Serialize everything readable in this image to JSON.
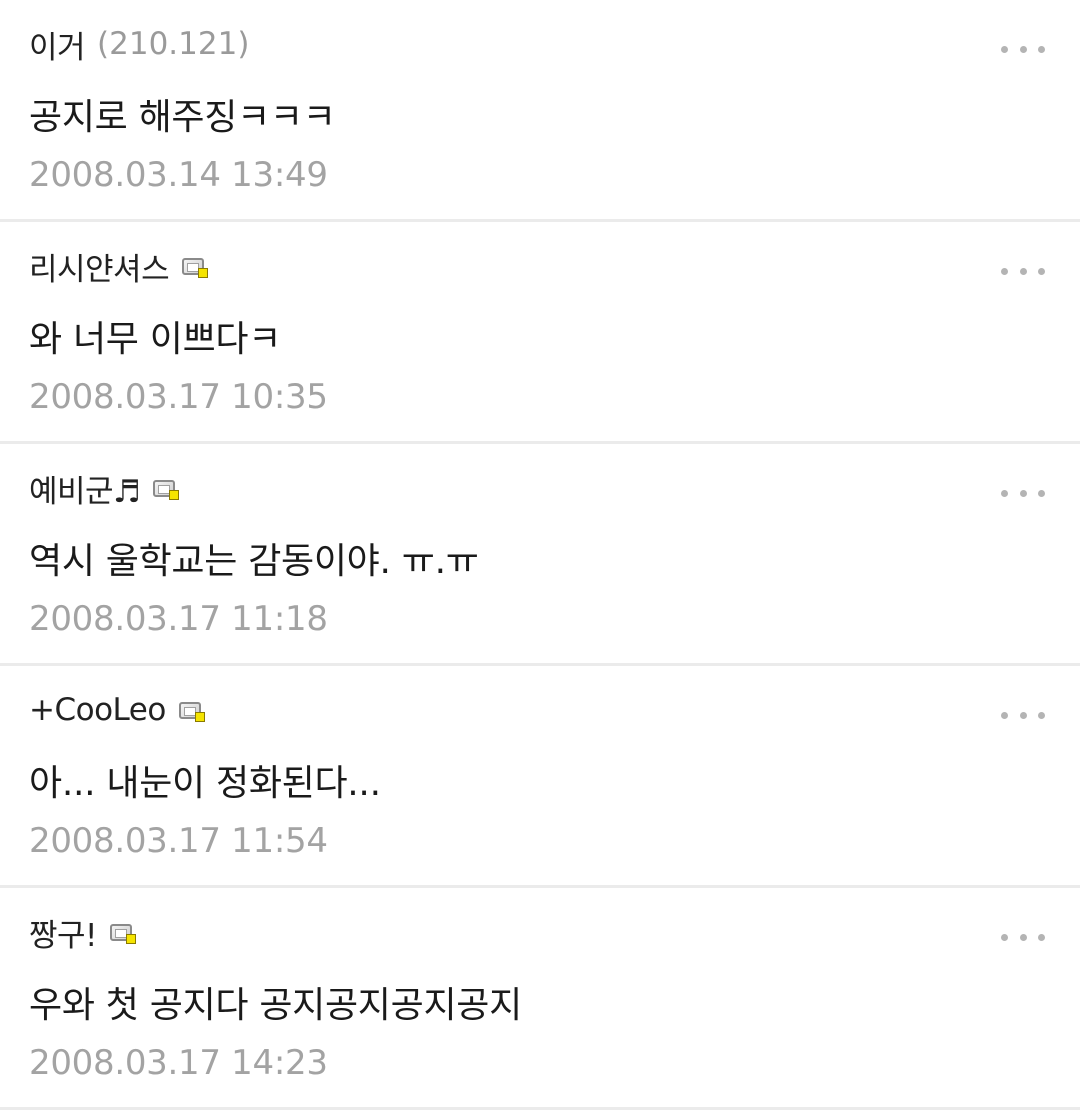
{
  "comments": [
    {
      "author": "이거",
      "ip": "(210.121)",
      "text": "공지로 해주징ㅋㅋㅋ",
      "time": "2008.03.14 13:49",
      "has_mobile_icon": false
    },
    {
      "author": "리시얀셔스",
      "ip": "",
      "text": "와 너무 이쁘다ㅋ",
      "time": "2008.03.17 10:35",
      "has_mobile_icon": true
    },
    {
      "author": "예비군♬",
      "ip": "",
      "text": "역시 울학교는 감동이야. ㅠ.ㅠ",
      "time": "2008.03.17 11:18",
      "has_mobile_icon": true
    },
    {
      "author": "+CooLeo",
      "ip": "",
      "text": "아... 내눈이 정화된다...",
      "time": "2008.03.17 11:54",
      "has_mobile_icon": true
    },
    {
      "author": "짱구!",
      "ip": "",
      "text": "우와 첫 공지다 공지공지공지공지",
      "time": "2008.03.17 14:23",
      "has_mobile_icon": true
    }
  ],
  "icons": {
    "more": "more-dots-icon",
    "badge": "mobile-badge-icon"
  },
  "colors": {
    "author": "#222222",
    "ip": "#9a9a9a",
    "text": "#1a1a1a",
    "time": "#a3a3a3",
    "divider": "#ebebeb",
    "more_dots": "#b4b4b4",
    "badge_accent": "#f5e400"
  }
}
